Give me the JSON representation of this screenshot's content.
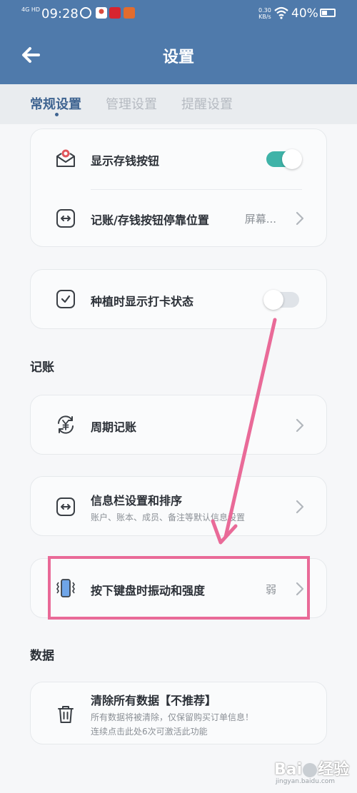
{
  "status_bar": {
    "network": "4G HD",
    "time": "09:28",
    "speed_value": "0.30",
    "speed_unit": "KB/s",
    "battery": "40%"
  },
  "header": {
    "title": "设置"
  },
  "tabs": [
    {
      "label": "常规设置",
      "active": true
    },
    {
      "label": "管理设置",
      "active": false
    },
    {
      "label": "提醒设置",
      "active": false
    }
  ],
  "general": {
    "show_save_button": {
      "label": "显示存钱按钮",
      "on": true
    },
    "button_dock": {
      "label": "记账/存钱按钮停靠位置",
      "value": "屏幕..."
    },
    "show_checkin": {
      "label": "种植时显示打卡状态",
      "on": false
    }
  },
  "accounting": {
    "section_title": "记账",
    "recurring": {
      "label": "周期记账"
    },
    "info_bar": {
      "label": "信息栏设置和排序",
      "sub": "账户、账本、成员、备注等默认信息设置"
    },
    "vibration": {
      "label": "按下键盘时振动和强度",
      "value": "弱"
    }
  },
  "data_section": {
    "section_title": "数据",
    "clear_all": {
      "label": "清除所有数据【不推荐】",
      "sub1": "所有数据将被清除，仅保留购买订单信息！",
      "sub2": "连续点击此处6次可激活此功能"
    }
  },
  "watermark": {
    "brand": "Bai",
    "brand2": "经验",
    "url": "jingyan.baidu.com"
  },
  "colors": {
    "header": "#4f7aab",
    "accent": "#3fb3a8",
    "annotation": "#e96a98",
    "active_tab": "#3f6491"
  }
}
